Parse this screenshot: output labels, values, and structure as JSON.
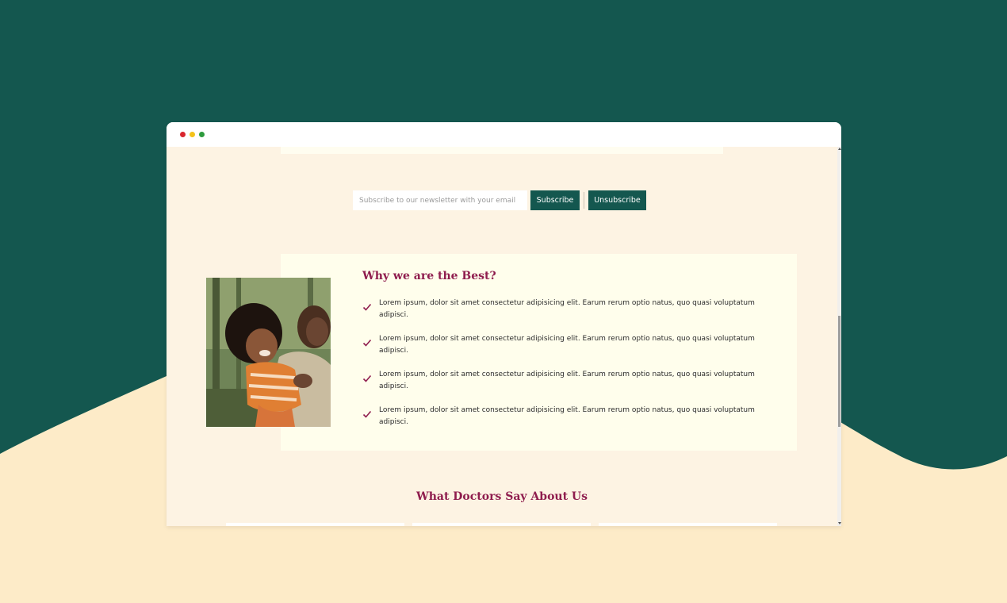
{
  "colors": {
    "background_dark": "#14574f",
    "background_light": "#fdebc8",
    "page_bg": "#fdf3e3",
    "card_bg": "#fffeec",
    "accent": "#8f1d4e",
    "button_bg": "#14574f"
  },
  "window": {
    "controls": [
      "close-dot",
      "minimize-dot",
      "maximize-dot"
    ]
  },
  "newsletter": {
    "placeholder": "Subscribe to our newsletter with your email",
    "value": "",
    "subscribe_label": "Subscribe",
    "unsubscribe_label": "Unsubscribe"
  },
  "why_best": {
    "title": "Why we are the Best?",
    "check_icon": "checkmark-icon",
    "items": [
      "Lorem ipsum, dolor sit amet consectetur adipisicing elit. Earum rerum optio natus, quo quasi voluptatum adipisci.",
      "Lorem ipsum, dolor sit amet consectetur adipisicing elit. Earum rerum optio natus, quo quasi voluptatum adipisci.",
      "Lorem ipsum, dolor sit amet consectetur adipisicing elit. Earum rerum optio natus, quo quasi voluptatum adipisci.",
      "Lorem ipsum, dolor sit amet consectetur adipisicing elit. Earum rerum optio natus, quo quasi voluptatum adipisci."
    ]
  },
  "testimonials": {
    "title": "What Doctors Say About Us"
  }
}
